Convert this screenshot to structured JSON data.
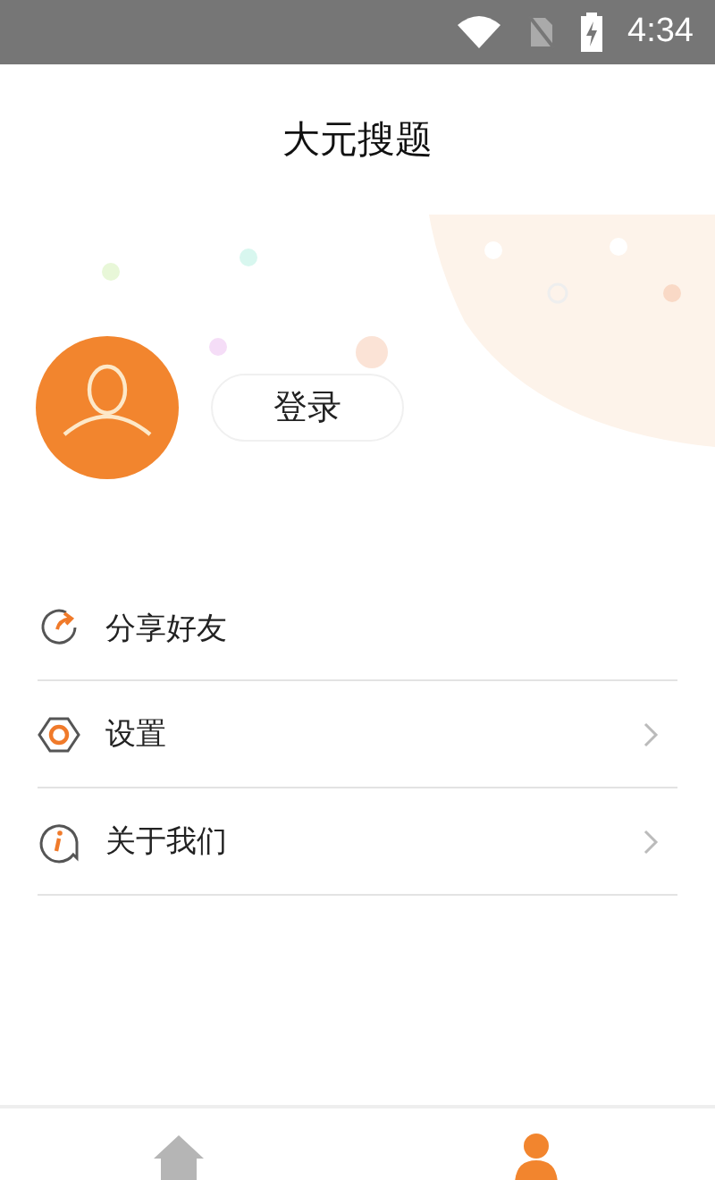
{
  "status_bar": {
    "time": "4:34"
  },
  "header": {
    "title": "大元搜题"
  },
  "profile": {
    "login_button": "登录"
  },
  "menu": [
    {
      "kind": "share",
      "label": "分享好友",
      "chevron": false
    },
    {
      "kind": "settings",
      "label": "设置",
      "chevron": true
    },
    {
      "kind": "about",
      "label": "关于我们",
      "chevron": true
    }
  ],
  "tabs": [
    {
      "kind": "home",
      "selected": false
    },
    {
      "kind": "me",
      "selected": true
    }
  ]
}
